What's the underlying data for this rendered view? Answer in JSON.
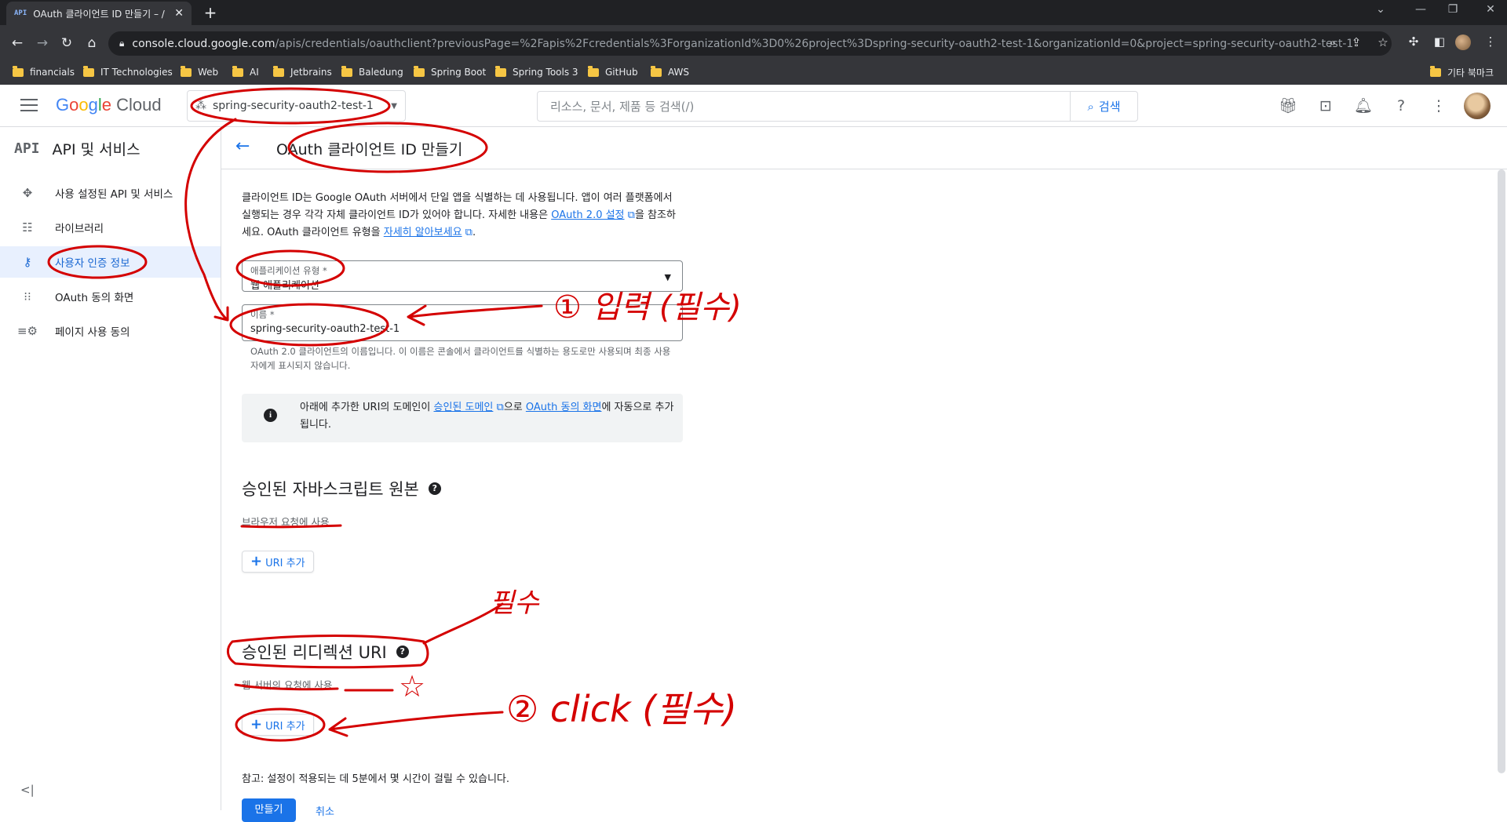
{
  "browser": {
    "tab_title": "OAuth 클라이언트 ID 만들기 – /",
    "tab_favicon": "API",
    "url_host": "console.cloud.google.com",
    "url_path": "/apis/credentials/oauthclient?previousPage=%2Fapis%2Fcredentials%3ForganizationId%3D0%26project%3Dspring-security-oauth2-test-1&organizationId=0&project=spring-security-oauth2-test-1",
    "bookmarks": [
      "financials",
      "IT Technologies",
      "Web",
      "AI",
      "Jetbrains",
      "Baledung",
      "Spring Boot",
      "Spring Tools 3",
      "GitHub",
      "AWS"
    ],
    "other_bookmarks": "기타 북마크"
  },
  "header": {
    "logo_google": "Google",
    "logo_cloud": "Cloud",
    "project_name": "spring-security-oauth2-test-1",
    "search_placeholder": "리소스, 문서, 제품 등 검색(/)",
    "search_button": "검색"
  },
  "sidebar": {
    "badge": "API",
    "title": "API 및 서비스",
    "items": [
      {
        "label": "사용 설정된 API 및 서비스",
        "icon": "move-icon"
      },
      {
        "label": "라이브러리",
        "icon": "library-icon"
      },
      {
        "label": "사용자 인증 정보",
        "icon": "key-icon",
        "active": true
      },
      {
        "label": "OAuth 동의 화면",
        "icon": "consent-icon"
      },
      {
        "label": "페이지 사용 동의",
        "icon": "settings-list-icon"
      }
    ],
    "collapse": "<|"
  },
  "page": {
    "title": "OAuth 클라이언트 ID 만들기",
    "intro_1": "클라이언트 ID는 Google OAuth 서버에서 단일 앱을 식별하는 데 사용됩니다. 앱이 여러 플랫폼에서 실행되는 경우 각각 자체 클라이언트 ID가 있어야 합니다. 자세한 내용은 ",
    "intro_link_1": "OAuth 2.0 설정",
    "intro_2": "을 참조하세요. OAuth 클라이언트 유형을 ",
    "intro_link_2": "자세히 알아보세요",
    "intro_3": ".",
    "app_type_label": "애플리케이션 유형 *",
    "app_type_value": "웹 애플리케이션",
    "name_label": "이름 *",
    "name_value": "spring-security-oauth2-test-1",
    "name_hint": "OAuth 2.0 클라이언트의 이름입니다. 이 이름은 콘솔에서 클라이언트를 식별하는 용도로만 사용되며 최종 사용자에게 표시되지 않습니다.",
    "info_1": "아래에 추가한 URI의 도메인이 ",
    "info_link_1": "승인된 도메인",
    "info_2": "으로 ",
    "info_link_2": "OAuth 동의 화면",
    "info_3": "에 자동으로 추가됩니다.",
    "js_origins_title": "승인된 자바스크립트 원본",
    "js_origins_sub": "브라우저 요청에 사용",
    "redirect_title": "승인된 리디렉션 URI",
    "redirect_sub": "웹 서버의 요청에 사용",
    "add_uri": "URI 추가",
    "note": "참고: 설정이 적용되는 데 5분에서 몇 시간이 걸릴 수 있습니다.",
    "create": "만들기",
    "cancel": "취소"
  },
  "annotations": {
    "input": "① 입력 (필수)",
    "click": "② click (필수)",
    "required": "필수"
  }
}
